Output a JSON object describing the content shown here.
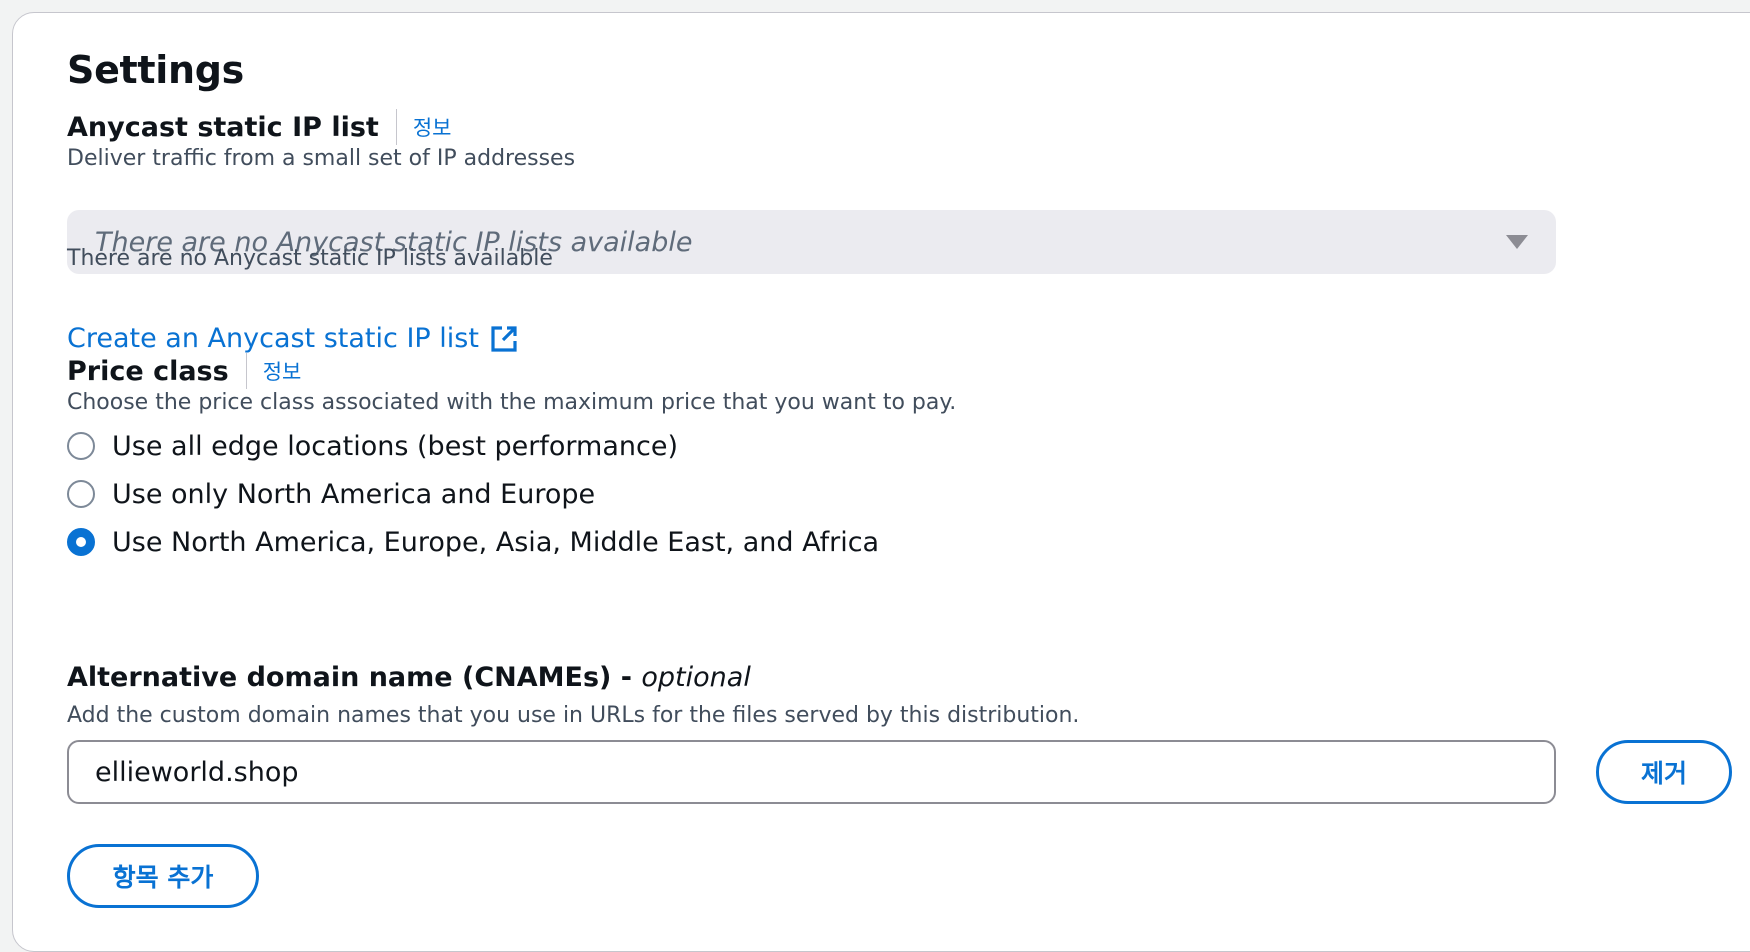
{
  "section": {
    "title": "Settings"
  },
  "anycast": {
    "label": "Anycast static IP list",
    "info": "정보",
    "description": "Deliver traffic from a small set of IP addresses",
    "select_placeholder": "There are no Anycast static IP lists available",
    "helper": "There are no Anycast static IP lists available",
    "create_link": "Create an Anycast static IP list",
    "create_link_icon": "external-link-icon"
  },
  "price_class": {
    "label": "Price class",
    "info": "정보",
    "description": "Choose the price class associated with the maximum price that you want to pay.",
    "options": [
      {
        "label": "Use all edge locations (best performance)",
        "checked": false
      },
      {
        "label": "Use only North America and Europe",
        "checked": false
      },
      {
        "label": "Use North America, Europe, Asia, Middle East, and Africa",
        "checked": true
      }
    ]
  },
  "cname": {
    "label": "Alternative domain name (CNAMEs)",
    "separator": " - ",
    "optional": "optional",
    "description": "Add the custom domain names that you use in URLs for the files served by this distribution.",
    "value": "ellieworld.shop",
    "remove_button": "제거",
    "add_button": "항목 추가"
  },
  "colors": {
    "accent": "#0972d3",
    "select_bg": "#ebebf0",
    "border": "#8c8c94",
    "text": "#0f141a",
    "muted": "#414d5c"
  }
}
